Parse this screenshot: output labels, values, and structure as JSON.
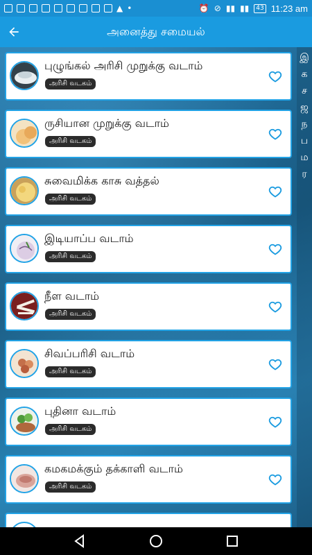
{
  "status_bar": {
    "time": "11:23 am",
    "battery": "43"
  },
  "app_bar": {
    "title": "அனைத்து சமையல்"
  },
  "recipes": [
    {
      "name": "புழுங்கல் அரிசி முறுக்கு வடாம்",
      "category": "அரிசி வடகம்"
    },
    {
      "name": "ருசியான முறுக்கு வடாம்",
      "category": "அரிசி வடகம்"
    },
    {
      "name": "சுவைமிக்க காசு வத்தல்",
      "category": "அரிசி வடகம்"
    },
    {
      "name": "இடியாப்ப வடாம்",
      "category": "அரிசி வடகம்"
    },
    {
      "name": "நீள வடாம்",
      "category": "அரிசி வடகம்"
    },
    {
      "name": "சிவப்பரிசி வடாம்",
      "category": "அரிசி வடகம்"
    },
    {
      "name": "புதினா வடாம்",
      "category": "அரிசி வடகம்"
    },
    {
      "name": "கமகமக்கும் தக்காளி வடாம்",
      "category": "அரிசி வடகம்"
    }
  ],
  "alphabet_index": [
    "இ",
    "க",
    "ச",
    "ஜ",
    "ந",
    "ப",
    "ம",
    "ர"
  ],
  "colors": {
    "accent": "#1a9be0",
    "card_border": "#22a3e6",
    "badge_bg": "#2b2b2b"
  },
  "icons": {
    "back": "arrow-left-icon",
    "favorite": "heart-outline-icon",
    "nav_back": "triangle-back-icon",
    "nav_home": "circle-home-icon",
    "nav_recents": "square-recents-icon"
  }
}
